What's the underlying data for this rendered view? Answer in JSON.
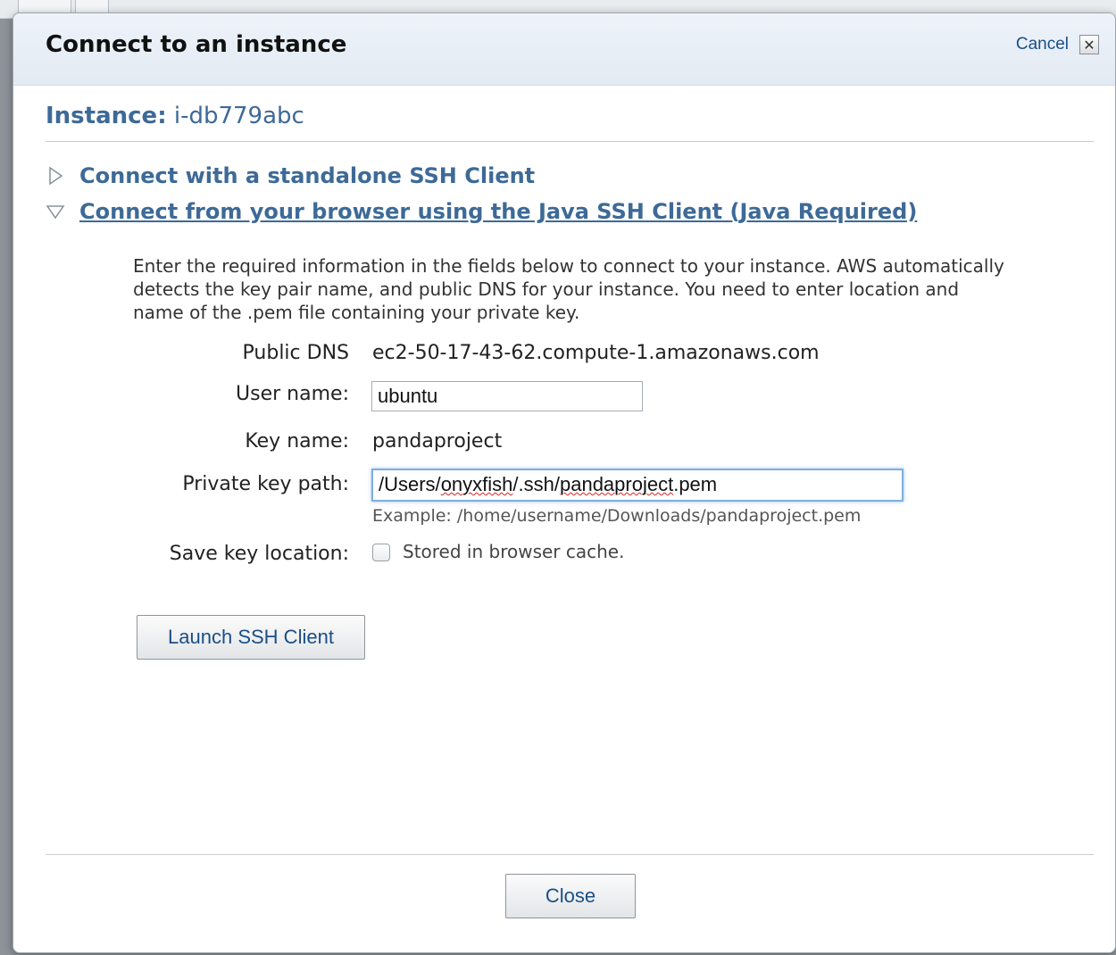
{
  "dialog": {
    "title": "Connect to an instance",
    "cancel_label": "Cancel",
    "close_glyph": "✕"
  },
  "instance": {
    "label": "Instance:",
    "id": "i-db779abc"
  },
  "sections": [
    {
      "label": "Connect with a standalone SSH Client",
      "expanded": false
    },
    {
      "label": "Connect from your browser using the Java SSH Client (Java Required)",
      "expanded": true
    }
  ],
  "description": "Enter the required information in the fields below to connect to your instance. AWS automatically detects the key pair name, and public DNS for your instance. You need to enter location and name of the .pem file containing your private key.",
  "form": {
    "public_dns_label": "Public DNS",
    "public_dns_value": "ec2-50-17-43-62.compute-1.amazonaws.com",
    "user_name_label": "User name:",
    "user_name_value": "ubuntu",
    "key_name_label": "Key name:",
    "key_name_value": "pandaproject",
    "private_key_label": "Private key path:",
    "private_key_prefix": "/Users/",
    "private_key_word1": "onyxfish",
    "private_key_mid": "/.ssh/",
    "private_key_word2": "pandaproject",
    "private_key_suffix": ".pem",
    "private_key_example": "Example: /home/username/Downloads/pandaproject.pem",
    "save_key_label": "Save key location:",
    "save_key_checkbox_label": "Stored in browser cache.",
    "save_key_checked": false
  },
  "buttons": {
    "launch": "Launch SSH Client",
    "close": "Close"
  },
  "colors": {
    "link_blue": "#3d6a97",
    "header_bg": "#e8eef5"
  }
}
